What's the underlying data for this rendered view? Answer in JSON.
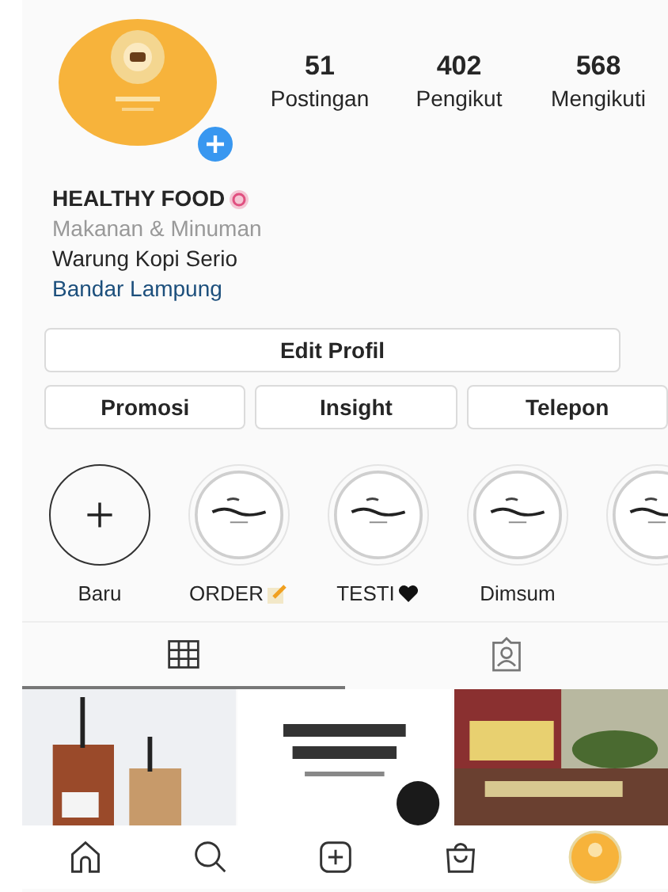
{
  "profile": {
    "stats": [
      {
        "value": "51",
        "label": "Postingan"
      },
      {
        "value": "402",
        "label": "Pengikut"
      },
      {
        "value": "568",
        "label": "Mengikuti"
      }
    ],
    "name": "HEALTHY FOOD",
    "category": "Makanan & Minuman",
    "bio": "Warung Kopi Serio",
    "location": "Bandar Lampung"
  },
  "actions": {
    "primary": "Edit Profil",
    "secondary": [
      "Promosi",
      "Insight",
      "Telepon"
    ]
  },
  "highlights": [
    {
      "kind": "new",
      "label": "Baru"
    },
    {
      "kind": "memo",
      "label": "ORDER"
    },
    {
      "kind": "heart",
      "label": "TESTI"
    },
    {
      "kind": "cover",
      "label": "Dimsum"
    },
    {
      "kind": "cover"
    }
  ],
  "tabs": [
    {
      "kind": "grid",
      "selected": true
    },
    {
      "kind": "tagged",
      "selected": false
    }
  ],
  "nav": [
    {
      "kind": "home"
    },
    {
      "kind": "search"
    },
    {
      "kind": "add"
    },
    {
      "kind": "shop"
    },
    {
      "kind": "profile"
    }
  ]
}
